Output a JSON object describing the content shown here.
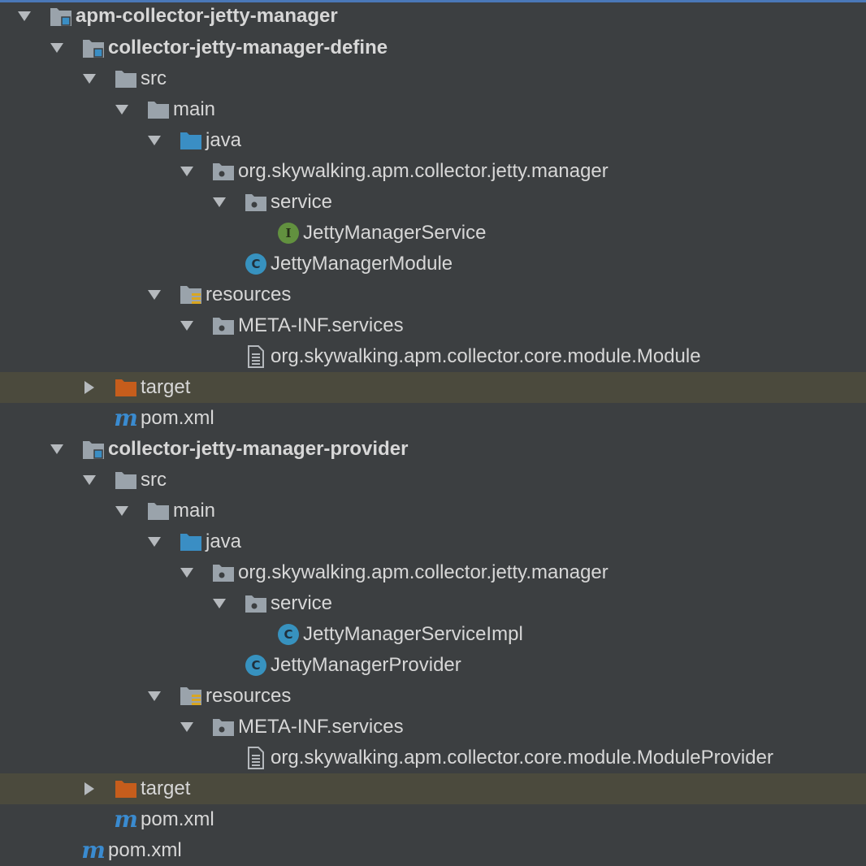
{
  "tree": {
    "rows": [
      {
        "label": "apm-collector-jetty-manager",
        "icon": "module-folder-icon"
      },
      {
        "label": "collector-jetty-manager-define",
        "icon": "module-folder-icon"
      },
      {
        "label": "src",
        "icon": "folder-icon"
      },
      {
        "label": "main",
        "icon": "folder-icon"
      },
      {
        "label": "java",
        "icon": "source-folder-icon"
      },
      {
        "label": "org.skywalking.apm.collector.jetty.manager",
        "icon": "package-icon"
      },
      {
        "label": "service",
        "icon": "package-icon"
      },
      {
        "label": "JettyManagerService",
        "icon": "interface-icon",
        "icon_letter": "I"
      },
      {
        "label": "JettyManagerModule",
        "icon": "class-icon",
        "icon_letter": "C"
      },
      {
        "label": "resources",
        "icon": "resources-folder-icon"
      },
      {
        "label": "META-INF.services",
        "icon": "package-icon"
      },
      {
        "label": "org.skywalking.apm.collector.core.module.Module",
        "icon": "text-file-icon"
      },
      {
        "label": "target",
        "icon": "excluded-folder-icon"
      },
      {
        "label": "pom.xml",
        "icon": "maven-icon",
        "icon_letter": "m"
      },
      {
        "label": "collector-jetty-manager-provider",
        "icon": "module-folder-icon"
      },
      {
        "label": "src",
        "icon": "folder-icon"
      },
      {
        "label": "main",
        "icon": "folder-icon"
      },
      {
        "label": "java",
        "icon": "source-folder-icon"
      },
      {
        "label": "org.skywalking.apm.collector.jetty.manager",
        "icon": "package-icon"
      },
      {
        "label": "service",
        "icon": "package-icon"
      },
      {
        "label": "JettyManagerServiceImpl",
        "icon": "class-icon",
        "icon_letter": "C"
      },
      {
        "label": "JettyManagerProvider",
        "icon": "class-icon",
        "icon_letter": "C"
      },
      {
        "label": "resources",
        "icon": "resources-folder-icon"
      },
      {
        "label": "META-INF.services",
        "icon": "package-icon"
      },
      {
        "label": "org.skywalking.apm.collector.core.module.ModuleProvider",
        "icon": "text-file-icon"
      },
      {
        "label": "target",
        "icon": "excluded-folder-icon"
      },
      {
        "label": "pom.xml",
        "icon": "maven-icon",
        "icon_letter": "m"
      },
      {
        "label": "pom.xml",
        "icon": "maven-icon",
        "icon_letter": "m"
      }
    ]
  },
  "colors": {
    "background": "#3c3f41",
    "excluded_row": "#4b4a3d",
    "text": "#d7d7d7",
    "folder_gray": "#9aa3ab",
    "source_blue": "#3a8ec4",
    "excluded_orange": "#c65d1c",
    "class_blue": "#3792bf",
    "interface_green": "#62913f",
    "selection_border": "#4a78b8"
  }
}
